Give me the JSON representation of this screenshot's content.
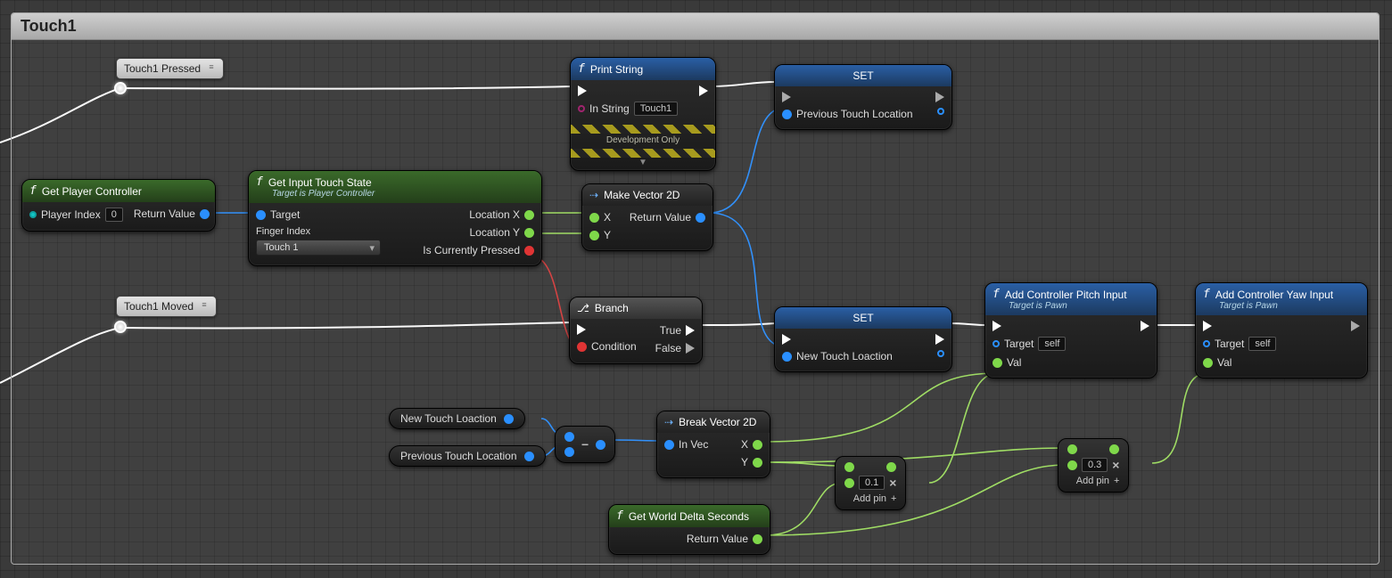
{
  "comment_title": "Touch1",
  "events": {
    "pressed": "Touch1 Pressed",
    "moved": "Touch1 Moved"
  },
  "nodes": {
    "getPlayerController": {
      "title": "Get Player Controller",
      "playerIndexLabel": "Player Index",
      "playerIndexValue": "0",
      "returnLabel": "Return Value"
    },
    "getInputTouchState": {
      "title": "Get Input Touch State",
      "subtitle": "Target is Player Controller",
      "targetLabel": "Target",
      "fingerIndexLabel": "Finger Index",
      "fingerIndexValue": "Touch 1",
      "locXLabel": "Location X",
      "locYLabel": "Location Y",
      "isPressedLabel": "Is Currently Pressed"
    },
    "printString": {
      "title": "Print String",
      "inStringLabel": "In String",
      "inStringValue": "Touch1",
      "devOnly": "Development Only"
    },
    "makeVector": {
      "title": "Make Vector 2D",
      "xLabel": "X",
      "yLabel": "Y",
      "returnLabel": "Return Value"
    },
    "set1": {
      "title": "SET",
      "varLabel": "Previous Touch Location"
    },
    "branch": {
      "title": "Branch",
      "conditionLabel": "Condition",
      "trueLabel": "True",
      "falseLabel": "False"
    },
    "set2": {
      "title": "SET",
      "varLabel": "New Touch Loaction"
    },
    "addPitch": {
      "title": "Add Controller Pitch Input",
      "subtitle": "Target is Pawn",
      "targetLabel": "Target",
      "targetValue": "self",
      "valLabel": "Val"
    },
    "addYaw": {
      "title": "Add Controller Yaw Input",
      "subtitle": "Target is Pawn",
      "targetLabel": "Target",
      "targetValue": "self",
      "valLabel": "Val"
    },
    "breakVector": {
      "title": "Break Vector 2D",
      "inVecLabel": "In Vec",
      "xLabel": "X",
      "yLabel": "Y"
    },
    "getWorldDelta": {
      "title": "Get World Delta Seconds",
      "returnLabel": "Return Value"
    }
  },
  "vars": {
    "newTouch": "New Touch Loaction",
    "prevTouch": "Previous Touch Location"
  },
  "multiply": {
    "val1": "0.1",
    "val2": "0.3",
    "addPin": "Add pin",
    "plus": "+"
  }
}
